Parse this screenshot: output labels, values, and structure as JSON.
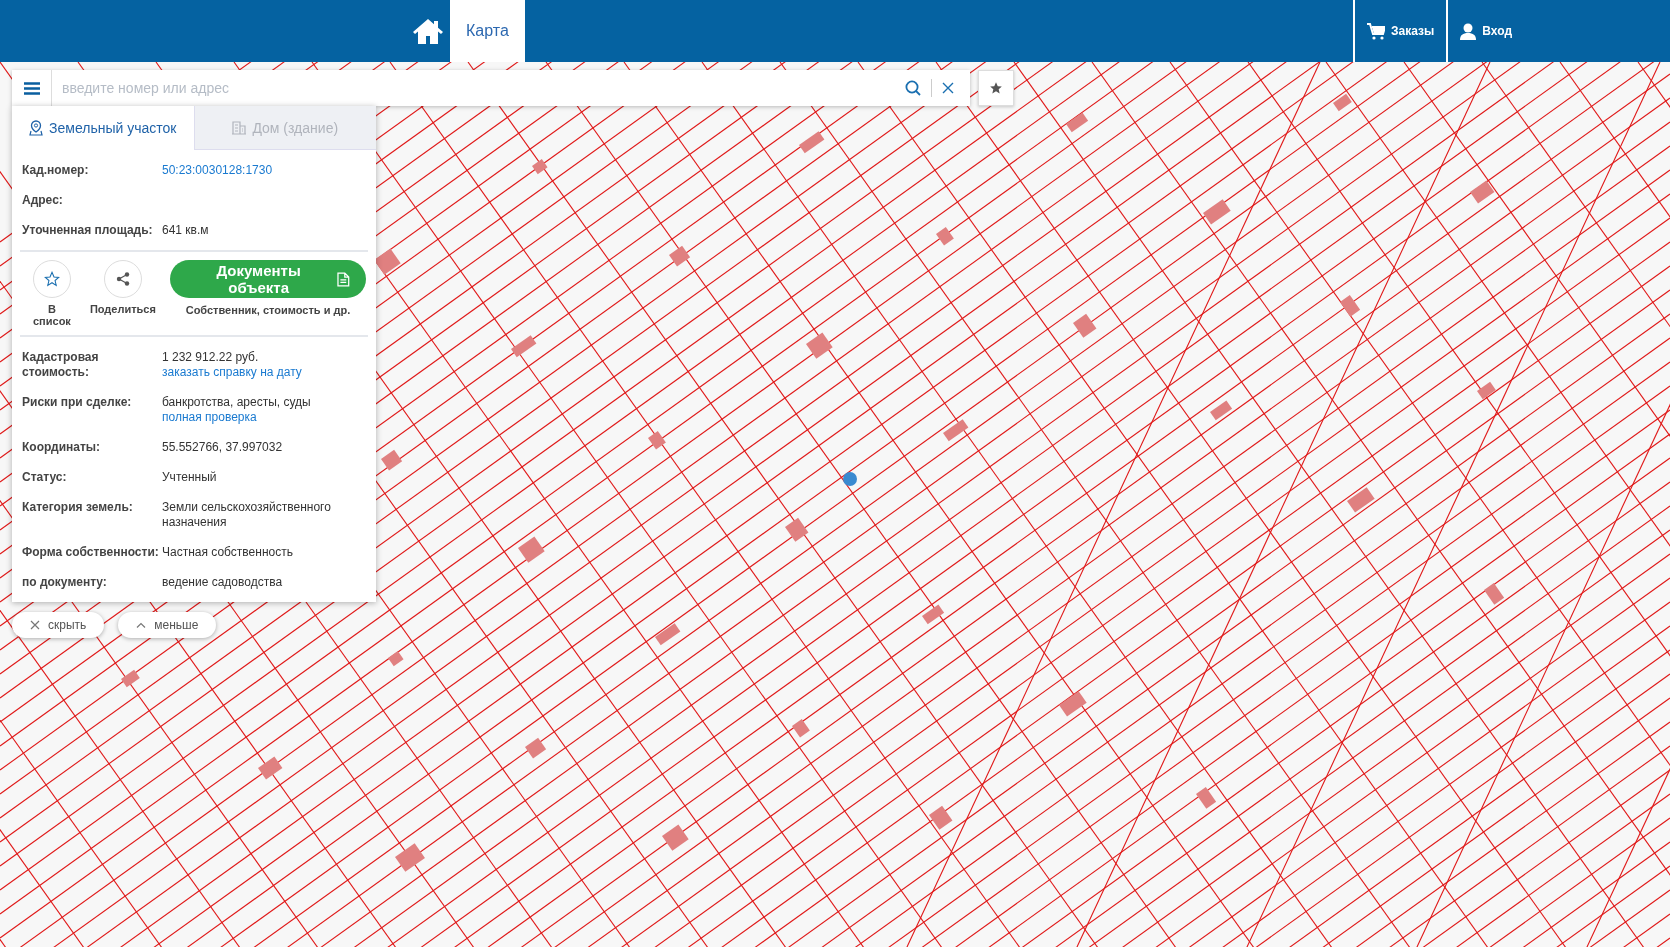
{
  "header": {
    "nav": [
      {
        "label": "Карта",
        "selected": true
      }
    ],
    "actions": [
      {
        "kind": "cart",
        "label": "Заказы"
      },
      {
        "kind": "user",
        "label": "Вход"
      }
    ]
  },
  "search": {
    "placeholder": "введите номер или адрес"
  },
  "panel": {
    "tabs": [
      {
        "kind": "land",
        "label": "Земельный участок",
        "selected": true
      },
      {
        "kind": "building",
        "label": "Дом (здание)",
        "selected": false
      }
    ],
    "top_rows": [
      {
        "label": "Кад.номер:",
        "values": [
          {
            "kind": "link",
            "text": "50:23:0030128:1730"
          }
        ]
      },
      {
        "label": "Адрес:",
        "values": []
      },
      {
        "label": "Уточненная площадь:",
        "values": [
          {
            "kind": "text",
            "text": "641 кв.м"
          }
        ]
      }
    ],
    "actions": [
      {
        "kind": "star",
        "label": "В список"
      },
      {
        "kind": "share",
        "label": "Поделиться"
      }
    ],
    "primary": {
      "label": "Документы объекта",
      "caption": "Собственник, стоимость и др."
    },
    "rows": [
      {
        "label": "Кадастровая стоимость:",
        "values": [
          {
            "kind": "text",
            "text": "1 232 912.22 руб."
          },
          {
            "kind": "link",
            "text": "заказать справку на дату"
          }
        ]
      },
      {
        "label": "Риски при сделке:",
        "values": [
          {
            "kind": "text",
            "text": "банкротства, аресты, суды"
          },
          {
            "kind": "link",
            "text": "полная проверка"
          }
        ]
      },
      {
        "label": "Координаты:",
        "values": [
          {
            "kind": "text",
            "text": "55.552766, 37.997032"
          }
        ]
      },
      {
        "label": "Статус:",
        "values": [
          {
            "kind": "text",
            "text": "Учтенный"
          }
        ]
      },
      {
        "label": "Категория земель:",
        "values": [
          {
            "kind": "text",
            "text": "Земли сельскохозяйственного назначения"
          }
        ]
      },
      {
        "label": "Форма собственности:",
        "values": [
          {
            "kind": "text",
            "text": "Частная собственность"
          }
        ]
      },
      {
        "label": "по документу:",
        "values": [
          {
            "kind": "text",
            "text": "ведение садоводства"
          }
        ]
      }
    ]
  },
  "below": [
    {
      "kind": "close",
      "label": "скрыть"
    },
    {
      "kind": "collapse",
      "label": "меньше"
    }
  ]
}
